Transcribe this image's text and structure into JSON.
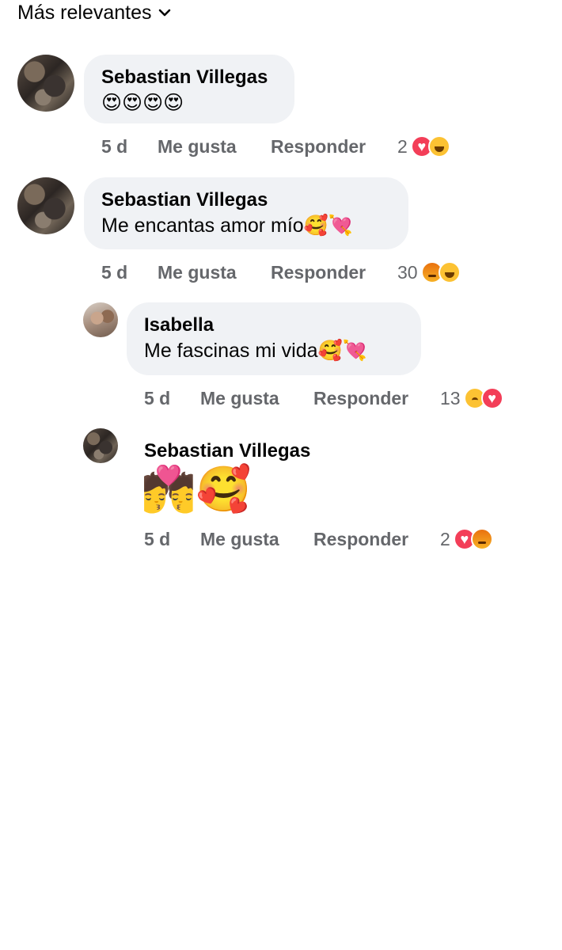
{
  "sort": {
    "label": "Más relevantes",
    "icon": "chevron-down-icon"
  },
  "comments": [
    {
      "author": "Sebastian Villegas",
      "text": "😍😍😍😍",
      "time": "5 d",
      "like": "Me gusta",
      "reply": "Responder",
      "reaction_count": "2",
      "reactions": [
        "love",
        "haha"
      ]
    },
    {
      "author": "Sebastian Villegas",
      "text": "Me encantas amor mío🥰💘",
      "time": "5 d",
      "like": "Me gusta",
      "reply": "Responder",
      "reaction_count": "30",
      "reactions": [
        "angry",
        "haha"
      ]
    }
  ],
  "replies": [
    {
      "author": "Isabella",
      "text": "Me fascinas mi vida🥰💘",
      "time": "5 d",
      "like": "Me gusta",
      "reply": "Responder",
      "reaction_count": "13",
      "reactions": [
        "sad",
        "love"
      ]
    },
    {
      "author": "Sebastian Villegas",
      "text": "💏🥰",
      "time": "5 d",
      "like": "Me gusta",
      "reply": "Responder",
      "reaction_count": "2",
      "reactions": [
        "love",
        "angry"
      ]
    }
  ],
  "colors": {
    "bubble": "#f0f2f5",
    "meta": "#65676b",
    "love": "#f33e58",
    "haha": "#fcc233",
    "angry": "#e9710f"
  }
}
